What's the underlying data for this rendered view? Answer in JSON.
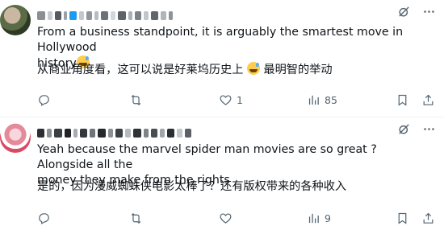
{
  "posts": [
    {
      "text_en_1": "From a business standpoint, it is arguably the smartest move in Hollywood",
      "text_en_2": "history",
      "text_zh_1": "从商业角度看，这可以说是好莱坞历史上",
      "text_zh_2": "最明智的举动",
      "stats": {
        "replies": "",
        "reposts": "",
        "likes": "1",
        "views": "85"
      }
    },
    {
      "text_en_1": "Yeah because the marvel spider man movies are so great ? Alongside all the",
      "text_en_2": "money they make from the rights",
      "text_zh_1": "是的，因为漫威蜘蛛侠电影太棒了？还有版权带来的各种收入",
      "stats": {
        "replies": "",
        "reposts": "",
        "likes": "",
        "views": "9"
      }
    }
  ],
  "icons": {
    "reply": "reply-icon",
    "repost": "repost-icon",
    "like": "heart-icon",
    "views": "views-icon",
    "bookmark": "bookmark-icon",
    "share": "share-icon",
    "grok": "grok-icon",
    "more": "more-icon"
  },
  "colors": {
    "text": "#0f1419",
    "muted": "#536471",
    "divider": "#eff3f4",
    "emoji": "#ffcc4d"
  }
}
